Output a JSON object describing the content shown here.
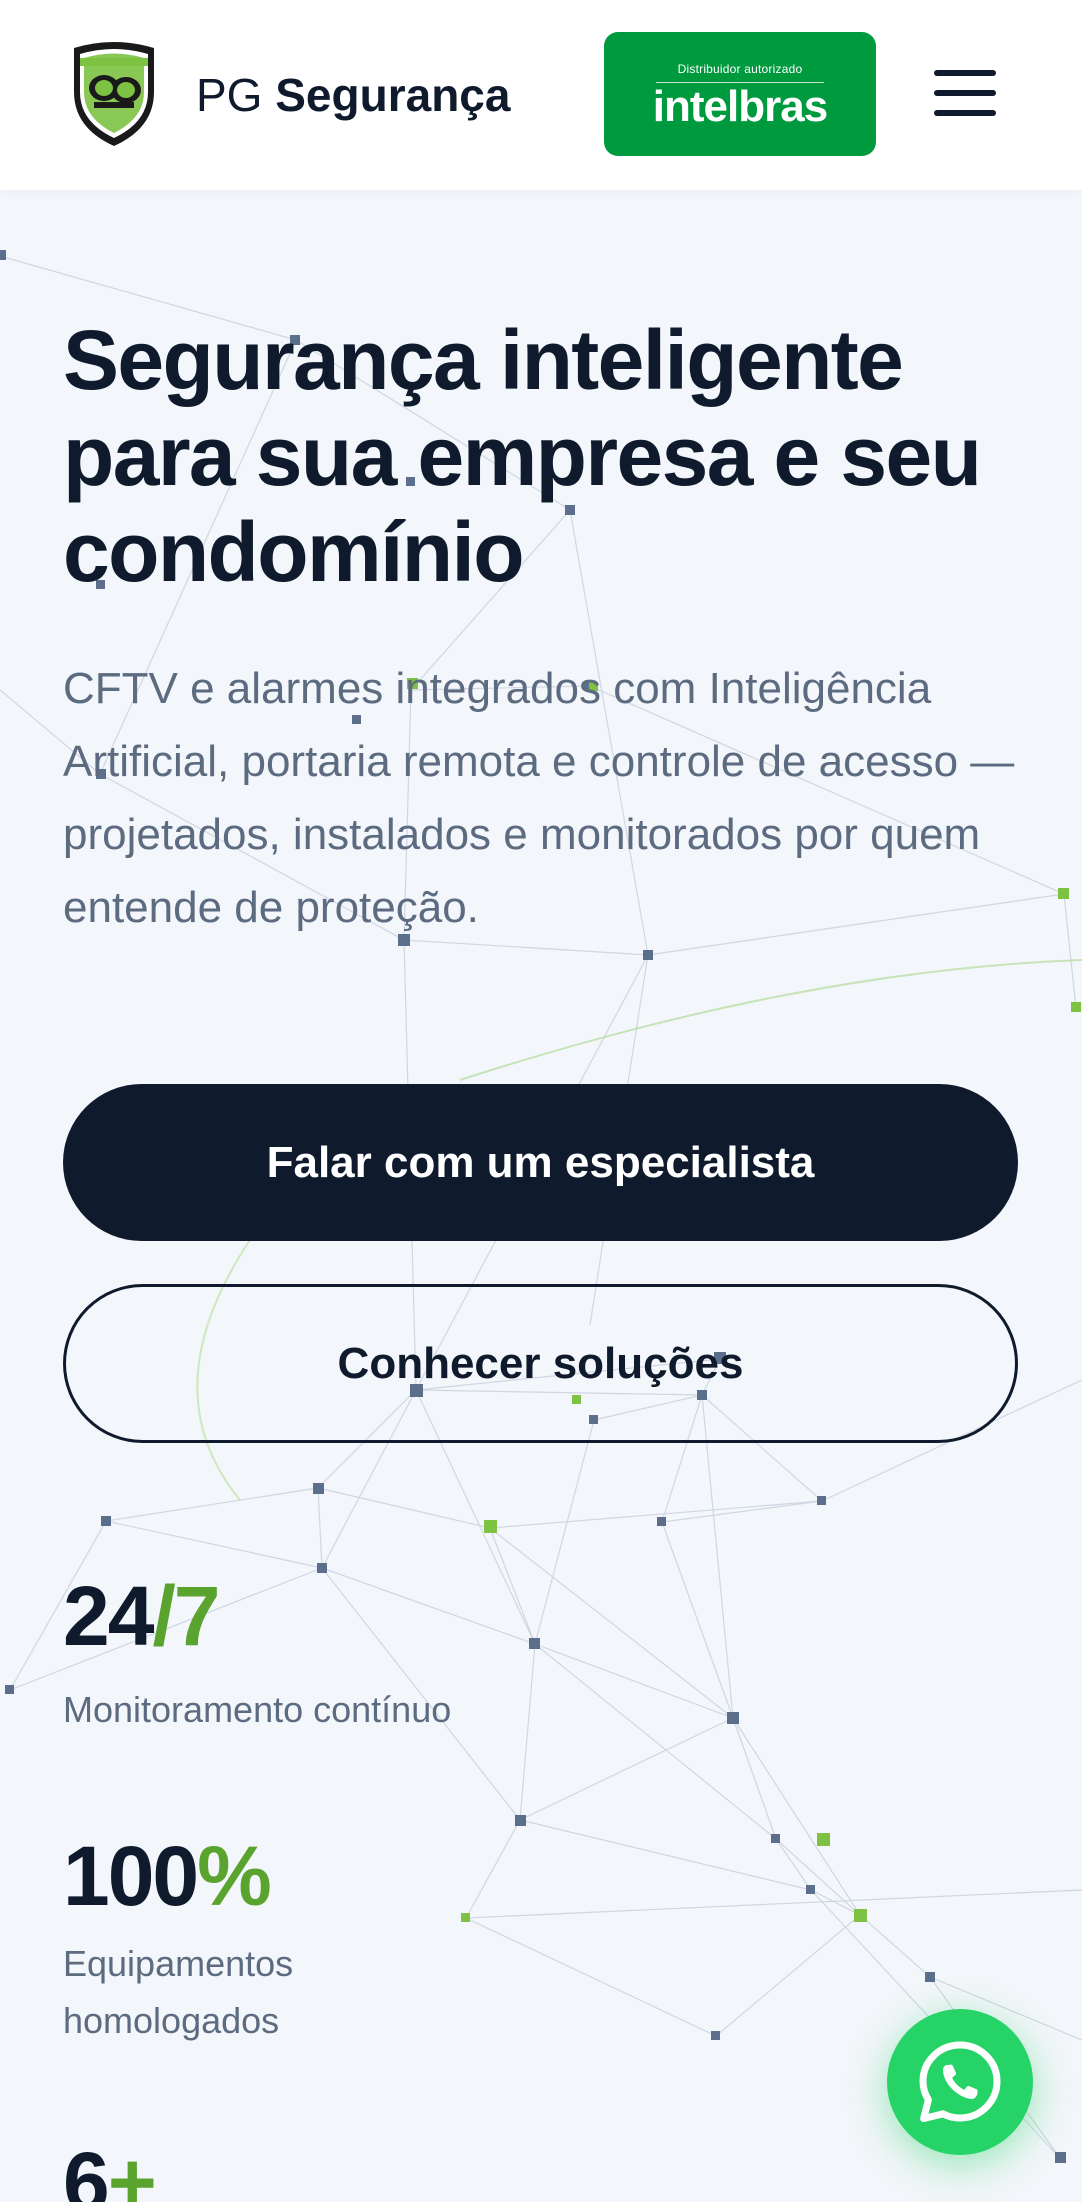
{
  "header": {
    "brand_prefix": "PG",
    "brand_bold": "Segurança",
    "partner_badge": {
      "tagline": "Distribuidor autorizado",
      "name": "intelbras",
      "color": "#009a3e"
    },
    "menu_icon": "hamburger-menu-icon"
  },
  "hero": {
    "title": "Segurança inteligente para sua empresa e seu condomínio",
    "description": "CFTV e alarmes integrados com Inteligência Artificial, portaria remota e controle de acesso — projetados, instalados e monitorados por quem entende de proteção.",
    "primary_cta": "Falar com um especialista",
    "secondary_cta": "Conhecer soluções"
  },
  "stats": [
    {
      "value": "24",
      "accent": "/7",
      "label": "Monitoramento contínuo"
    },
    {
      "value": "100",
      "accent": "%",
      "label": "Equipamentos homologados"
    },
    {
      "value": "6",
      "accent": "+",
      "label": ""
    }
  ],
  "floating": {
    "whatsapp_icon": "whatsapp-icon"
  },
  "colors": {
    "dark": "#0f1b2d",
    "accent_green": "#5aa32f",
    "whatsapp_green": "#25d366",
    "muted_text": "#5c6b80",
    "background": "#f3f6fa"
  }
}
